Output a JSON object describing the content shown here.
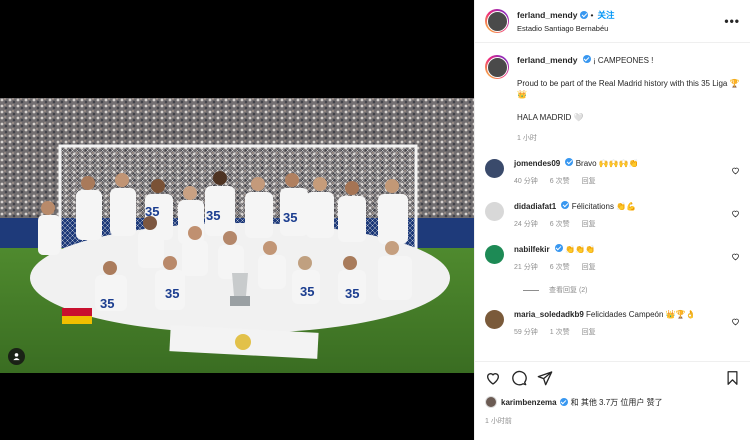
{
  "header": {
    "username": "ferland_mendy",
    "follow_label": "关注",
    "location": "Estadio Santiago Bernabéu",
    "more_label": "•••"
  },
  "caption": {
    "username": "ferland_mendy",
    "title": "¡ CAMPEONES !",
    "line1": "Proud to be part of the Real Madrid history with this 35 Liga 🏆👑",
    "line2": "HALA MADRID 🤍",
    "time": "1 小时"
  },
  "comments": [
    {
      "username": "jomendes09",
      "verified": true,
      "text": "Bravo 🙌🙌🙌👏",
      "time": "40 分钟",
      "likes": "6 次赞",
      "reply": "回复",
      "avatar_color": "#3a4a6b"
    },
    {
      "username": "didadiafat1",
      "verified": true,
      "text": "Félicitations 👏💪",
      "time": "24 分钟",
      "likes": "6 次赞",
      "reply": "回复",
      "avatar_color": "#d8d8d8"
    },
    {
      "username": "nabilfekir",
      "verified": true,
      "text": "👏👏👏",
      "time": "21 分钟",
      "likes": "6 次赞",
      "reply": "回复",
      "avatar_color": "#1d8a55"
    },
    {
      "username": "maria_soledadkb9",
      "verified": false,
      "text": "Felicidades Campeón 👑🏆👌",
      "time": "59 分钟",
      "likes": "1 次赞",
      "reply": "回复",
      "avatar_color": "#7a5a3a"
    }
  ],
  "view_replies": "查看回复 (2)",
  "footer": {
    "liked_by_user": "karimbenzema",
    "liked_by_suffix": "和 其他 3.7万 位用户 赞了",
    "time": "1 小时前"
  },
  "colors": {
    "accent": "#0095f6",
    "verified": "#3897f0",
    "meta_gray": "#8e8e8e"
  },
  "icons": [
    "heart-icon",
    "comment-icon",
    "share-icon",
    "bookmark-icon",
    "user-tag-icon",
    "more-icon"
  ]
}
